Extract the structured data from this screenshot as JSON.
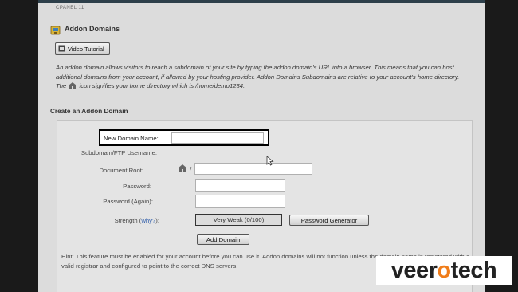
{
  "header": {
    "breadcrumb": "CPANEL 11",
    "title": "Addon Domains"
  },
  "video_button": {
    "label": "Video Tutorial"
  },
  "description": {
    "part1": "An addon domain allows visitors to reach a subdomain of your site by typing the addon domain's URL into a browser. This means that you can host additional domains from your account, if allowed by your hosting provider. Addon Domains Subdomains are relative to your account's home directory. The ",
    "part2": " icon signifies your home directory which is /home/demo1234."
  },
  "form": {
    "section_title": "Create an Addon Domain",
    "new_domain_label": "New Domain Name:",
    "new_domain_value": "",
    "subdomain_label": "Subdomain/FTP Username:",
    "docroot_label": "Document Root:",
    "docroot_prefix": "/",
    "docroot_value": "",
    "password_label": "Password:",
    "password_again_label": "Password (Again):",
    "strength_label": "Strength (",
    "strength_why": "why?",
    "strength_label_end": "):",
    "strength_value": "Very Weak (0/100)",
    "password_generator_label": "Password Generator",
    "add_domain_label": "Add Domain",
    "hint": "Hint: This feature must be enabled for your account before you can use it. Addon domains will not function unless the domain name is registered with a valid registrar and configured to point to the correct DNS servers."
  },
  "watermark": {
    "part1": "veer",
    "part2": "o",
    "part3": "tech"
  },
  "colors": {
    "page_bg": "#dcdcdc",
    "link": "#2b5aa8",
    "brand_orange": "#f07d1a"
  },
  "icons": [
    "addon-domains-icon",
    "film-icon",
    "home-icon",
    "cursor-icon"
  ]
}
